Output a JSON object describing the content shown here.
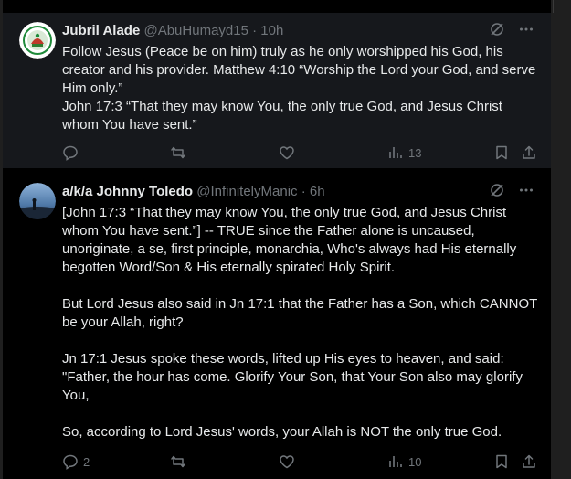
{
  "posts": [
    {
      "author": "Jubril Alade",
      "handle": "@AbuHumayd15",
      "time": "10h",
      "text": "Follow Jesus (Peace be on him) truly as he only worshipped his God, his creator and his provider. Matthew 4:10 “Worship the Lord your God, and serve Him only.”\nJohn 17:3 “That they may know You, the only true God, and Jesus Christ whom You have sent.”",
      "reply_count": "",
      "repost_count": "",
      "like_count": "",
      "views": "13"
    },
    {
      "author": "a/k/a Johnny Toledo",
      "handle": "@InfinitelyManic",
      "time": "6h",
      "text": "[John 17:3 “That they may know You, the only true God, and Jesus Christ whom You have sent.”] -- TRUE since the Father alone is uncaused, unoriginate, a se, first principle, monarchia, Who's always had His eternally begotten Word/Son & His eternally spirated Holy Spirit.\n\nBut Lord Jesus also said in Jn 17:1 that the Father has a Son, which CANNOT be your Allah, right?\n\nJn 17:1 Jesus spoke these words, lifted up His eyes to heaven, and said: \"Father, the hour has come. Glorify Your Son, that Your Son also may glorify You,\n\nSo, according to Lord Jesus' words, your Allah is NOT the only true God.",
      "reply_count": "2",
      "repost_count": "",
      "like_count": "",
      "views": "10"
    }
  ],
  "separator": "·",
  "icons": {
    "grok": "grok-slash-icon",
    "more": "more-dots-icon",
    "reply": "reply-bubble-icon",
    "repost": "repost-arrows-icon",
    "like": "heart-icon",
    "views": "views-bars-icon",
    "bookmark": "bookmark-icon",
    "share": "share-upload-icon"
  },
  "colors": {
    "background": "#000000",
    "highlight_background": "#16181c",
    "text": "#e7e9ea",
    "muted": "#71767b"
  }
}
